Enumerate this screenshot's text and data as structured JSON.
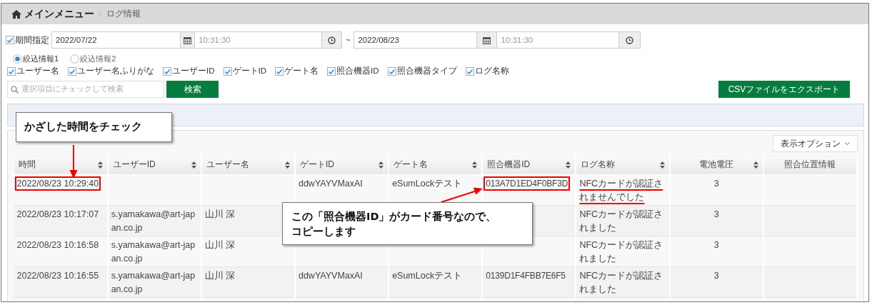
{
  "breadcrumb": {
    "home": "メインメニュー",
    "current": "ログ情報"
  },
  "period": {
    "label": "期間指定",
    "checked": true,
    "from_date": "2022/07/22",
    "from_time": "10:31:30",
    "separator": "~",
    "to_date": "2022/08/23",
    "to_time": "10:31:30"
  },
  "filter_sets": [
    {
      "label": "絞込情報1",
      "selected": true
    },
    {
      "label": "絞込情報2",
      "selected": false
    }
  ],
  "fields": [
    {
      "label": "ユーザー名",
      "checked": true
    },
    {
      "label": "ユーザー名ふりがな",
      "checked": true
    },
    {
      "label": "ユーザーID",
      "checked": true
    },
    {
      "label": "ゲートID",
      "checked": true
    },
    {
      "label": "ゲート名",
      "checked": true
    },
    {
      "label": "照合機器ID",
      "checked": true
    },
    {
      "label": "照合機器タイプ",
      "checked": true
    },
    {
      "label": "ログ名称",
      "checked": true
    }
  ],
  "search": {
    "placeholder": "選択項目にチェックして検索",
    "button": "検索"
  },
  "export_button": "CSVファイルをエクスポート",
  "display_options": "表示オプション",
  "table": {
    "columns": [
      {
        "label": "時間",
        "sortable": true
      },
      {
        "label": "ユーザーID",
        "sortable": true
      },
      {
        "label": "ユーザー名",
        "sortable": true
      },
      {
        "label": "ゲートID",
        "sortable": true
      },
      {
        "label": "ゲート名",
        "sortable": true
      },
      {
        "label": "照合機器ID",
        "sortable": true
      },
      {
        "label": "ログ名称",
        "sortable": true
      },
      {
        "label": "電池電圧",
        "sortable": true
      },
      {
        "label": "照合位置情報",
        "sortable": false
      }
    ],
    "rows": [
      {
        "cells": [
          {
            "text": "2022/08/23 10:29:40",
            "highlighted": true
          },
          null,
          null,
          {
            "text": "ddwYAYVMaxAI"
          },
          {
            "text": "eSumLockテスト"
          },
          {
            "text": "013A7D1ED4F0BF3D",
            "highlighted": true
          },
          {
            "text": "NFCカードが認証されませんでした",
            "underlined": true
          },
          {
            "text": "3"
          },
          null
        ]
      },
      {
        "cells": [
          {
            "text": "2022/08/23 10:17:07"
          },
          {
            "text": "s.yamakawa@art-japan.co.jp"
          },
          {
            "text": "山川 深"
          },
          null,
          null,
          null,
          {
            "text": "NFCカードが認証されました"
          },
          {
            "text": "3"
          },
          null
        ]
      },
      {
        "cells": [
          {
            "text": "2022/08/23 10:16:58"
          },
          {
            "text": "s.yamakawa@art-japan.co.jp"
          },
          {
            "text": "山川 深"
          },
          null,
          null,
          null,
          {
            "text": "NFCカードが認証されました"
          },
          {
            "text": "3"
          },
          null
        ]
      },
      {
        "cells": [
          {
            "text": "2022/08/23 10:16:55"
          },
          {
            "text": "s.yamakawa@art-japan.co.jp"
          },
          {
            "text": "山川 深"
          },
          {
            "text": "ddwYAYVMaxAI"
          },
          {
            "text": "eSumLockテスト"
          },
          {
            "text": "0139D1F4FBB7E6F5"
          },
          {
            "text": "NFCカードが認証されました"
          },
          {
            "text": "3"
          },
          null
        ]
      }
    ]
  },
  "callouts": [
    {
      "lines": [
        "かざした時間をチェック"
      ]
    },
    {
      "lines": [
        "この「照合機器ID」がカード番号なので、",
        "コピーします"
      ]
    }
  ]
}
